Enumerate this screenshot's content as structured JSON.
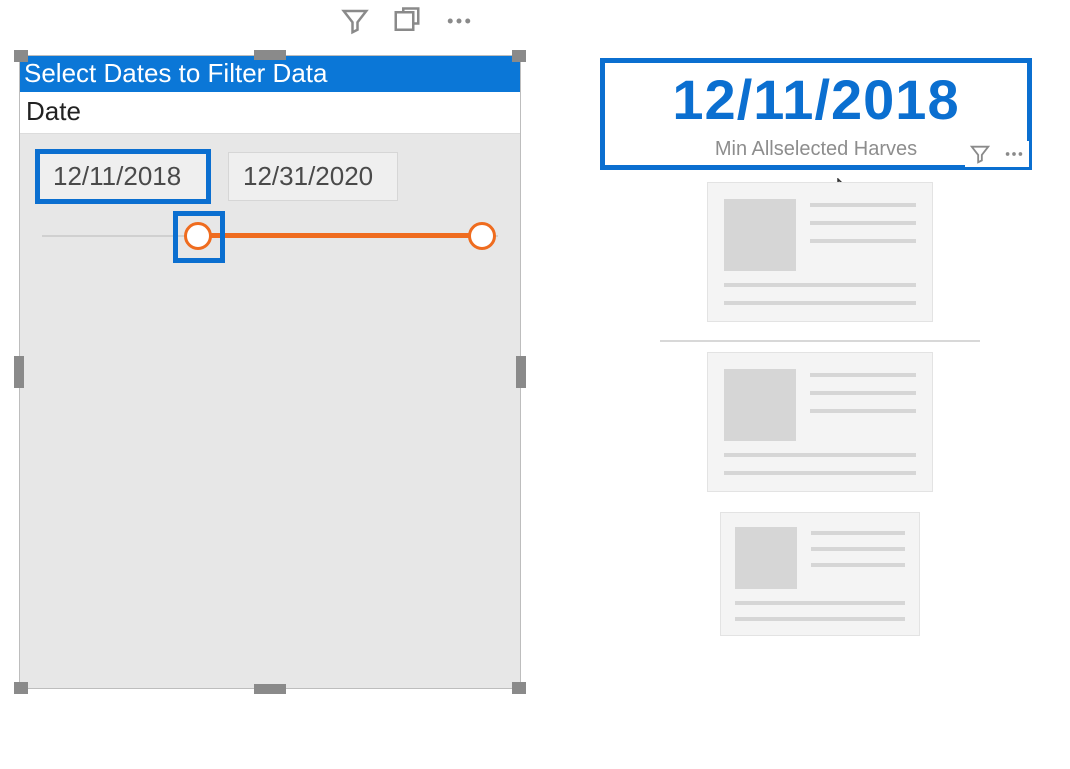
{
  "slicer": {
    "title": "Select Dates to Filter Data",
    "field_label": "Date",
    "start_date": "12/11/2018",
    "end_date": "12/31/2020"
  },
  "card": {
    "value": "12/11/2018",
    "label": "Min Allselected Harves"
  },
  "icons": {
    "filter": "filter-icon",
    "focus": "focus-mode-icon",
    "more": "more-options-icon"
  }
}
